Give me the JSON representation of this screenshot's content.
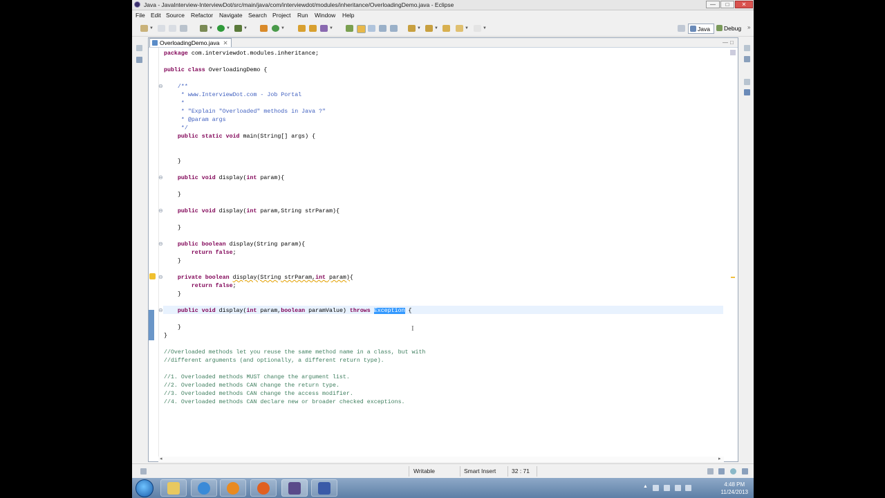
{
  "window": {
    "title": "Java - JavaInterview-InterviewDot/src/main/java/com/interviewdot/modules/inheritance/OverloadingDemo.java - Eclipse",
    "minimize": "—",
    "maximize": "□",
    "close": "✕"
  },
  "menu": [
    "File",
    "Edit",
    "Source",
    "Refactor",
    "Navigate",
    "Search",
    "Project",
    "Run",
    "Window",
    "Help"
  ],
  "perspectives": {
    "java": "Java",
    "debug": "Debug",
    "more": "»"
  },
  "editor": {
    "tab_label": "OverloadingDemo.java",
    "tab_close": "✕",
    "minimize": "—",
    "maximize": "□"
  },
  "code": {
    "l1_kw": "package",
    "l1_rest": " com.interviewdot.modules.inheritance;",
    "l2_kw": "public class",
    "l2_rest": " OverloadingDemo {",
    "l3": "    /**",
    "l4": "     * www.InterviewDot.com - Job Portal",
    "l5": "     *",
    "l6": "     * \"Explain \"Overloaded\" methods in Java ?\"",
    "l7": "     * @param args",
    "l8": "     */",
    "l9_kw": "    public static void",
    "l9_rest": " main(String[] args) {",
    "l10": "    }",
    "l11_kw": "    public void",
    "l11_rest": " display(",
    "l11_kw2": "int",
    "l11_rest2": " param){",
    "l12": "    }",
    "l13_kw": "    public void",
    "l13_rest": " display(",
    "l13_kw2": "int",
    "l13_rest2": " param,String strParam){",
    "l14": "    }",
    "l15_kw": "    public boolean",
    "l15_rest": " display(String param){",
    "l16_kw": "        return false",
    "l16_rest": ";",
    "l17": "    }",
    "l18_kw": "    private boolean",
    "l18_rest_a": " ",
    "l18_warn": "display(String strParam,",
    "l18_kw2": "int",
    "l18_warn2": " param)",
    "l18_rest_b": "{",
    "l19_kw": "        return false",
    "l19_rest": ";",
    "l20": "    }",
    "l21_kw": "    public void",
    "l21_rest": " display(",
    "l21_kw2": "int",
    "l21_rest2": " param,",
    "l21_kw3": "boolean",
    "l21_rest3": " paramValue) ",
    "l21_kw4": "throws",
    "l21_rest4": " ",
    "l21_sel": "Exception",
    "l21_rest5": " {",
    "l22": "    }",
    "l23": "}",
    "c1": "//Overloaded methods let you reuse the same method name in a class, but with",
    "c2": "//different arguments (and optionally, a different return type).",
    "c3": "//1. Overloaded methods MUST change the argument list.",
    "c4": "//2. Overloaded methods CAN change the return type.",
    "c5": "//3. Overloaded methods CAN change the access modifier.",
    "c6": "//4. Overloaded methods CAN declare new or broader checked exceptions."
  },
  "status": {
    "writable": "Writable",
    "insert_mode": "Smart Insert",
    "position": "32 : 71"
  },
  "taskbar": {
    "time": "4:48 PM",
    "date": "11/24/2013"
  },
  "colors": {
    "keyword": "#7f0055",
    "javadoc": "#3f5fbf",
    "comment": "#3f7f5f",
    "selection": "#3399ff",
    "current_line": "#e8f2fe"
  }
}
